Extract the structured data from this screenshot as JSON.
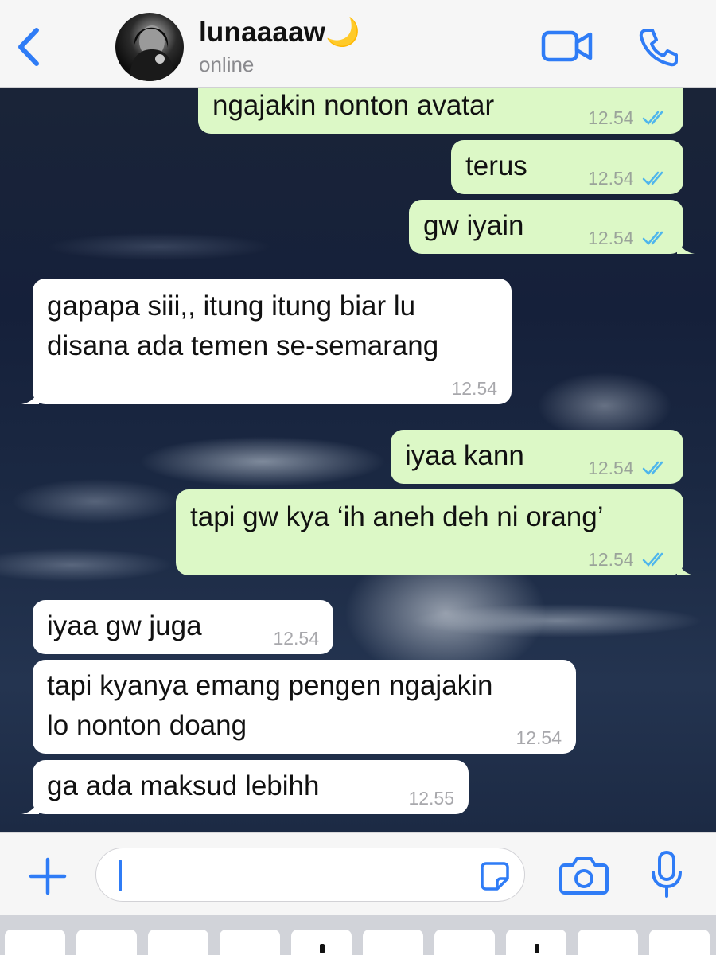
{
  "header": {
    "back_icon": "chevron-left-icon",
    "contact_name": "lunaaaaw🌙",
    "status": "online",
    "video_icon": "video-camera-icon",
    "call_icon": "phone-icon",
    "accent_color": "#2f7cf6"
  },
  "messages": [
    {
      "direction": "outgoing",
      "text": "ngajakin nonton avatar",
      "time": "12.54",
      "read": true
    },
    {
      "direction": "outgoing",
      "text": "terus",
      "time": "12.54",
      "read": true
    },
    {
      "direction": "outgoing",
      "text": "gw iyain",
      "time": "12.54",
      "read": true
    },
    {
      "direction": "incoming",
      "lines": [
        "gapapa siii,, itung itung biar lu",
        "disana ada temen se-semarang"
      ],
      "time": "12.54"
    },
    {
      "direction": "outgoing",
      "text": "iyaa kann",
      "time": "12.54",
      "read": true
    },
    {
      "direction": "outgoing",
      "text": "tapi gw kya ‘ih aneh deh ni orang’",
      "time": "12.54",
      "read": true
    },
    {
      "direction": "incoming",
      "text": "iyaa gw juga",
      "time": "12.54"
    },
    {
      "direction": "incoming",
      "lines": [
        "tapi kyanya emang pengen ngajakin",
        "lo nonton doang"
      ],
      "time": "12.54"
    },
    {
      "direction": "incoming",
      "text": "ga ada maksud lebihh",
      "time": "12.55"
    }
  ],
  "colors": {
    "outgoing_bubble": "#dcf8c6",
    "incoming_bubble": "#ffffff",
    "read_ticks": "#4fb6ec"
  },
  "input_bar": {
    "plus_icon": "plus-icon",
    "input_value": "",
    "sticker_icon": "sticker-icon",
    "camera_icon": "camera-icon",
    "mic_icon": "microphone-icon"
  }
}
